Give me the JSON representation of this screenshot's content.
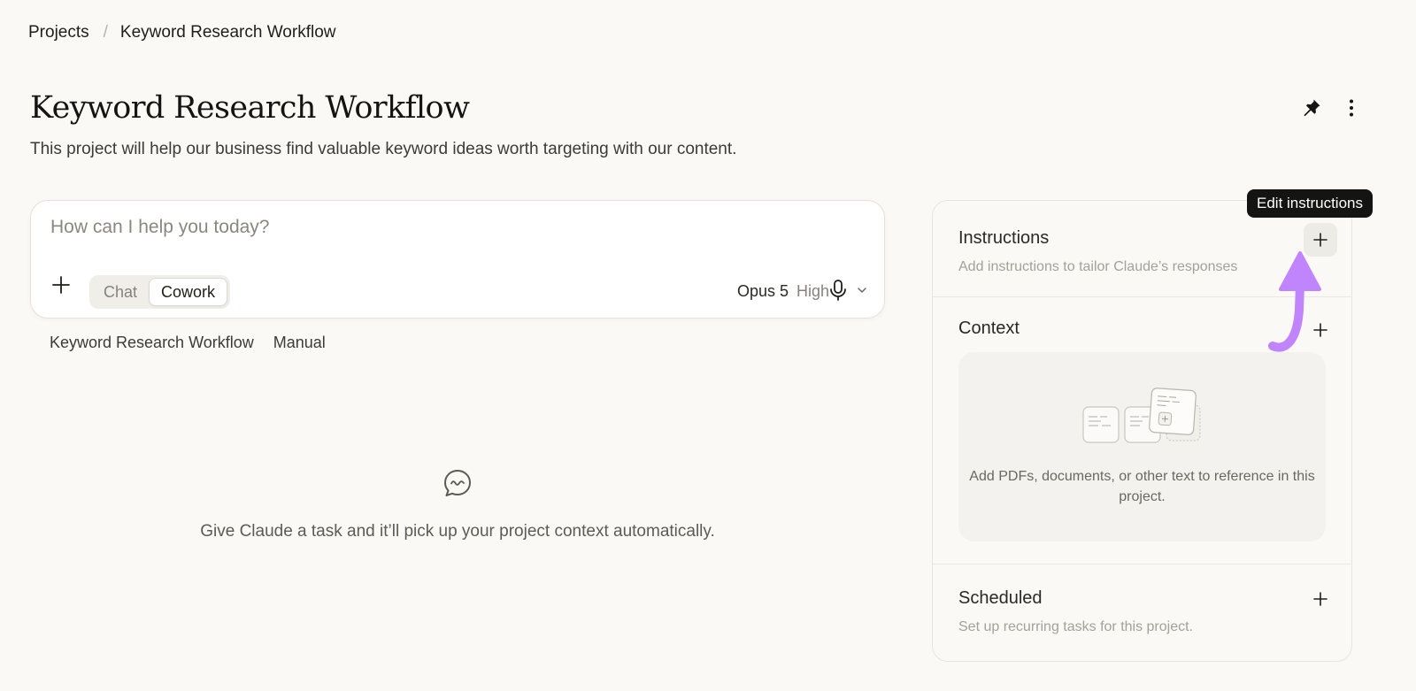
{
  "breadcrumb": {
    "root": "Projects",
    "separator": "/",
    "current": "Keyword Research Workflow"
  },
  "project": {
    "title": "Keyword Research Workflow",
    "description": "This project will help our business find valuable keyword ideas worth targeting with our content."
  },
  "composer": {
    "placeholder": "How can I help you today?",
    "modes": [
      "Chat",
      "Cowork"
    ],
    "active_mode": "Cowork",
    "model": "Opus 5",
    "effort": "High"
  },
  "chips": [
    "Keyword Research Workflow",
    "Manual"
  ],
  "empty_state": {
    "icon": "chat-bubble-icon",
    "message": "Give Claude a task and it’ll pick up your project context automatically."
  },
  "panel": {
    "instructions": {
      "title": "Instructions",
      "subtitle": "Add instructions to tailor Claude’s responses"
    },
    "context": {
      "title": "Context",
      "empty_text": "Add PDFs, documents, or other text to reference in this project."
    },
    "scheduled": {
      "title": "Scheduled",
      "subtitle": "Set up recurring tasks for this project."
    }
  },
  "tooltip": "Edit instructions",
  "colors": {
    "background": "#faf9f6",
    "accent_arrow": "#c084fc",
    "tooltip_bg": "#141413"
  }
}
